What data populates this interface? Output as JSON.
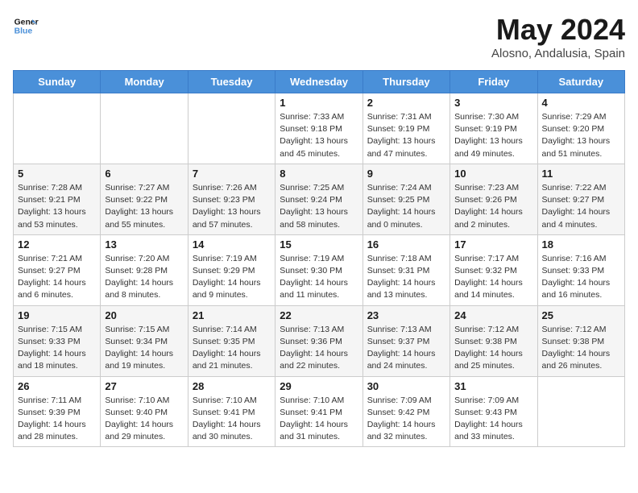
{
  "header": {
    "logo_line1": "General",
    "logo_line2": "Blue",
    "month_year": "May 2024",
    "location": "Alosno, Andalusia, Spain"
  },
  "days_of_week": [
    "Sunday",
    "Monday",
    "Tuesday",
    "Wednesday",
    "Thursday",
    "Friday",
    "Saturday"
  ],
  "weeks": [
    [
      {
        "day": "",
        "info": ""
      },
      {
        "day": "",
        "info": ""
      },
      {
        "day": "",
        "info": ""
      },
      {
        "day": "1",
        "info": "Sunrise: 7:33 AM\nSunset: 9:18 PM\nDaylight: 13 hours\nand 45 minutes."
      },
      {
        "day": "2",
        "info": "Sunrise: 7:31 AM\nSunset: 9:19 PM\nDaylight: 13 hours\nand 47 minutes."
      },
      {
        "day": "3",
        "info": "Sunrise: 7:30 AM\nSunset: 9:19 PM\nDaylight: 13 hours\nand 49 minutes."
      },
      {
        "day": "4",
        "info": "Sunrise: 7:29 AM\nSunset: 9:20 PM\nDaylight: 13 hours\nand 51 minutes."
      }
    ],
    [
      {
        "day": "5",
        "info": "Sunrise: 7:28 AM\nSunset: 9:21 PM\nDaylight: 13 hours\nand 53 minutes."
      },
      {
        "day": "6",
        "info": "Sunrise: 7:27 AM\nSunset: 9:22 PM\nDaylight: 13 hours\nand 55 minutes."
      },
      {
        "day": "7",
        "info": "Sunrise: 7:26 AM\nSunset: 9:23 PM\nDaylight: 13 hours\nand 57 minutes."
      },
      {
        "day": "8",
        "info": "Sunrise: 7:25 AM\nSunset: 9:24 PM\nDaylight: 13 hours\nand 58 minutes."
      },
      {
        "day": "9",
        "info": "Sunrise: 7:24 AM\nSunset: 9:25 PM\nDaylight: 14 hours\nand 0 minutes."
      },
      {
        "day": "10",
        "info": "Sunrise: 7:23 AM\nSunset: 9:26 PM\nDaylight: 14 hours\nand 2 minutes."
      },
      {
        "day": "11",
        "info": "Sunrise: 7:22 AM\nSunset: 9:27 PM\nDaylight: 14 hours\nand 4 minutes."
      }
    ],
    [
      {
        "day": "12",
        "info": "Sunrise: 7:21 AM\nSunset: 9:27 PM\nDaylight: 14 hours\nand 6 minutes."
      },
      {
        "day": "13",
        "info": "Sunrise: 7:20 AM\nSunset: 9:28 PM\nDaylight: 14 hours\nand 8 minutes."
      },
      {
        "day": "14",
        "info": "Sunrise: 7:19 AM\nSunset: 9:29 PM\nDaylight: 14 hours\nand 9 minutes."
      },
      {
        "day": "15",
        "info": "Sunrise: 7:19 AM\nSunset: 9:30 PM\nDaylight: 14 hours\nand 11 minutes."
      },
      {
        "day": "16",
        "info": "Sunrise: 7:18 AM\nSunset: 9:31 PM\nDaylight: 14 hours\nand 13 minutes."
      },
      {
        "day": "17",
        "info": "Sunrise: 7:17 AM\nSunset: 9:32 PM\nDaylight: 14 hours\nand 14 minutes."
      },
      {
        "day": "18",
        "info": "Sunrise: 7:16 AM\nSunset: 9:33 PM\nDaylight: 14 hours\nand 16 minutes."
      }
    ],
    [
      {
        "day": "19",
        "info": "Sunrise: 7:15 AM\nSunset: 9:33 PM\nDaylight: 14 hours\nand 18 minutes."
      },
      {
        "day": "20",
        "info": "Sunrise: 7:15 AM\nSunset: 9:34 PM\nDaylight: 14 hours\nand 19 minutes."
      },
      {
        "day": "21",
        "info": "Sunrise: 7:14 AM\nSunset: 9:35 PM\nDaylight: 14 hours\nand 21 minutes."
      },
      {
        "day": "22",
        "info": "Sunrise: 7:13 AM\nSunset: 9:36 PM\nDaylight: 14 hours\nand 22 minutes."
      },
      {
        "day": "23",
        "info": "Sunrise: 7:13 AM\nSunset: 9:37 PM\nDaylight: 14 hours\nand 24 minutes."
      },
      {
        "day": "24",
        "info": "Sunrise: 7:12 AM\nSunset: 9:38 PM\nDaylight: 14 hours\nand 25 minutes."
      },
      {
        "day": "25",
        "info": "Sunrise: 7:12 AM\nSunset: 9:38 PM\nDaylight: 14 hours\nand 26 minutes."
      }
    ],
    [
      {
        "day": "26",
        "info": "Sunrise: 7:11 AM\nSunset: 9:39 PM\nDaylight: 14 hours\nand 28 minutes."
      },
      {
        "day": "27",
        "info": "Sunrise: 7:10 AM\nSunset: 9:40 PM\nDaylight: 14 hours\nand 29 minutes."
      },
      {
        "day": "28",
        "info": "Sunrise: 7:10 AM\nSunset: 9:41 PM\nDaylight: 14 hours\nand 30 minutes."
      },
      {
        "day": "29",
        "info": "Sunrise: 7:10 AM\nSunset: 9:41 PM\nDaylight: 14 hours\nand 31 minutes."
      },
      {
        "day": "30",
        "info": "Sunrise: 7:09 AM\nSunset: 9:42 PM\nDaylight: 14 hours\nand 32 minutes."
      },
      {
        "day": "31",
        "info": "Sunrise: 7:09 AM\nSunset: 9:43 PM\nDaylight: 14 hours\nand 33 minutes."
      },
      {
        "day": "",
        "info": ""
      }
    ]
  ]
}
